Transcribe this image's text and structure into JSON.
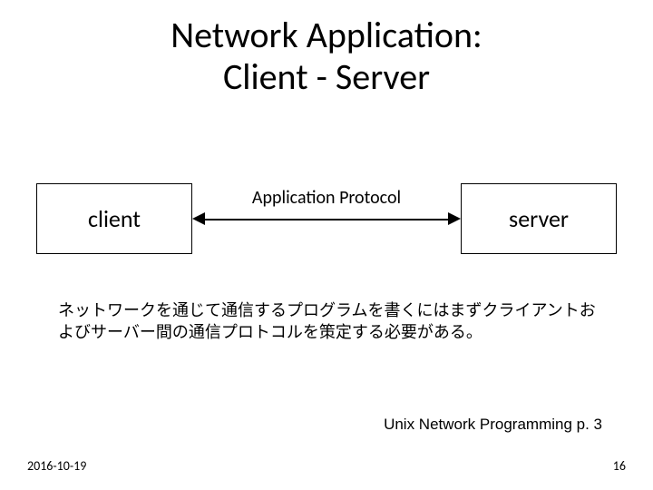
{
  "title_line1": "Network Application:",
  "title_line2": "Client - Server",
  "diagram": {
    "client_label": "client",
    "server_label": "server",
    "protocol_label": "Application Protocol"
  },
  "description": "ネットワークを通じて通信するプログラムを書くにはまずクライアントおよびサーバー間の通信プロトコルを策定する必要がある。",
  "reference": "Unix Network Programming p. 3",
  "footer": {
    "date": "2016-10-19",
    "page": "16"
  }
}
